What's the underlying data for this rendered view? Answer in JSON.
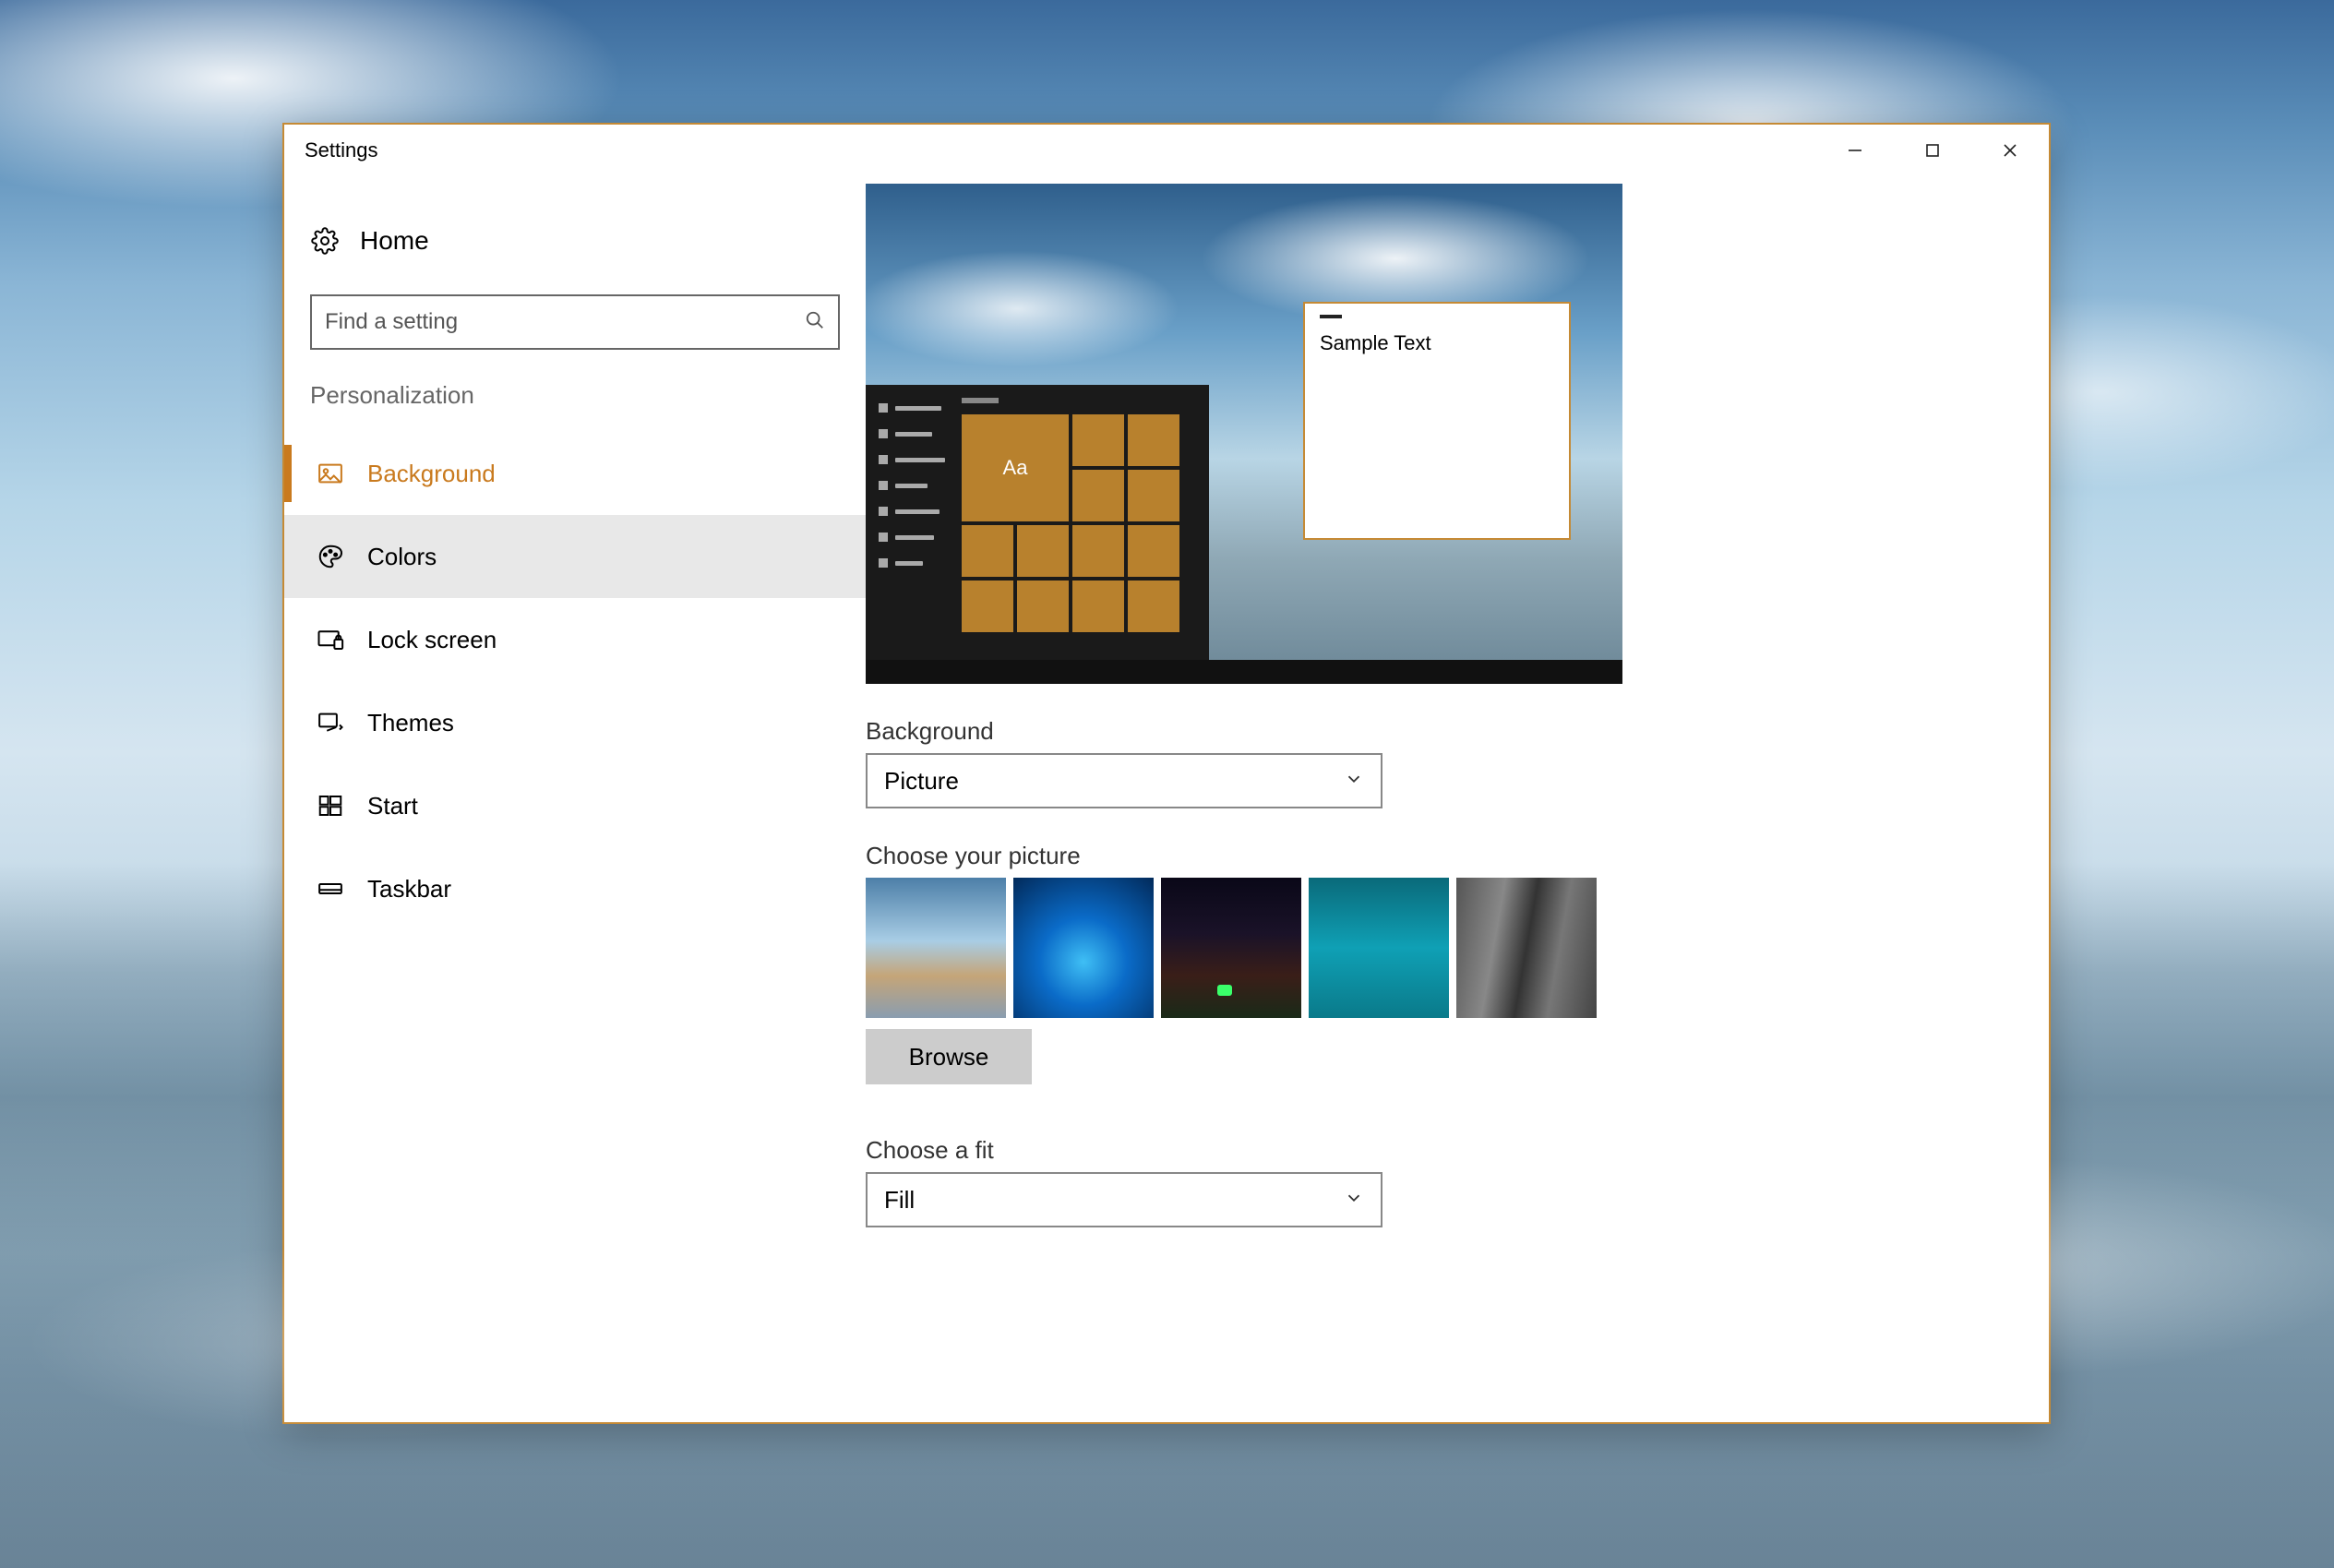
{
  "window": {
    "title": "Settings"
  },
  "sidebar": {
    "home": "Home",
    "search_placeholder": "Find a setting",
    "category": "Personalization",
    "items": [
      {
        "label": "Background",
        "icon": "picture-icon",
        "active": true
      },
      {
        "label": "Colors",
        "icon": "palette-icon",
        "hovered": true
      },
      {
        "label": "Lock screen",
        "icon": "lock-screen-icon"
      },
      {
        "label": "Themes",
        "icon": "themes-icon"
      },
      {
        "label": "Start",
        "icon": "start-icon"
      },
      {
        "label": "Taskbar",
        "icon": "taskbar-icon"
      }
    ]
  },
  "main": {
    "preview_sample_text": "Sample Text",
    "preview_tile_text": "Aa",
    "background_label": "Background",
    "background_value": "Picture",
    "choose_picture_label": "Choose your picture",
    "browse_label": "Browse",
    "choose_fit_label": "Choose a fit",
    "fit_value": "Fill",
    "thumbnails": [
      {
        "name": "beach-wallpaper"
      },
      {
        "name": "windows-light-wallpaper"
      },
      {
        "name": "night-sky-wallpaper"
      },
      {
        "name": "underwater-wallpaper"
      },
      {
        "name": "rock-monochrome-wallpaper"
      }
    ]
  },
  "accent_color": "#c97a1e"
}
